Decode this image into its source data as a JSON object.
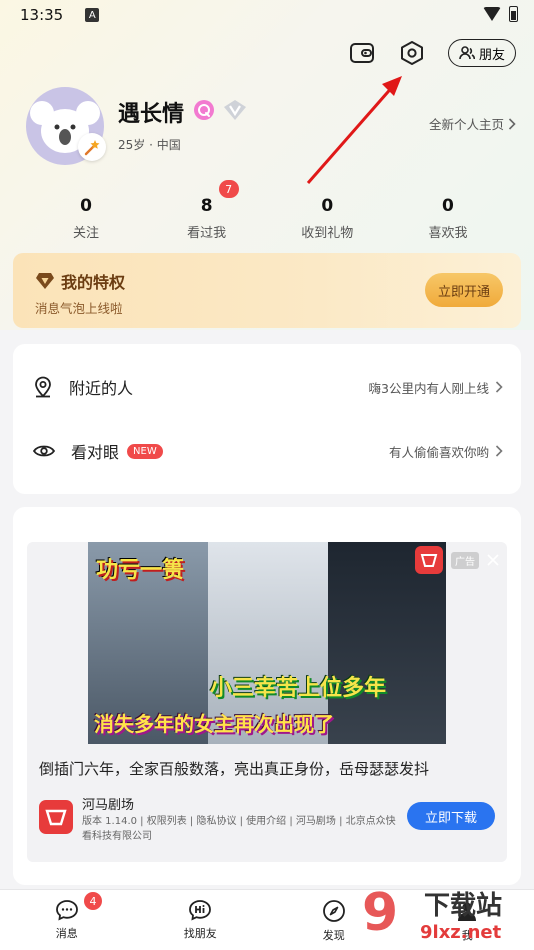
{
  "status_bar": {
    "time": "13:35",
    "indicator": "A"
  },
  "top_actions": {
    "wallet_icon": "wallet-icon",
    "settings_icon": "settings-hexagon-icon",
    "friends_label": "朋友"
  },
  "profile": {
    "username": "遇长情",
    "meta": "25岁 · 中国",
    "homepage_link": "全新个人主页",
    "badges": [
      "pink-chat-badge",
      "vip-v-badge"
    ]
  },
  "stats": [
    {
      "value": "0",
      "label": "关注"
    },
    {
      "value": "8",
      "label": "看过我",
      "badge": "7"
    },
    {
      "value": "0",
      "label": "收到礼物"
    },
    {
      "value": "0",
      "label": "喜欢我"
    }
  ],
  "privilege": {
    "title": "我的特权",
    "subtitle": "消息气泡上线啦",
    "button": "立即开通"
  },
  "menu": [
    {
      "label": "附近的人",
      "hint": "嗨3公里内有人刚上线",
      "icon": "location-pin-icon"
    },
    {
      "label": "看对眼",
      "tag": "NEW",
      "hint": "有人偷偷喜欢你哟",
      "icon": "eye-icon"
    }
  ],
  "ad": {
    "caption_top": "功亏一篑",
    "caption_mid": "小三幸苦上位多年",
    "caption_bottom": "消失多年的女主再次出现了",
    "tag": "广告",
    "title": "倒插门六年，全家百般数落，亮出真正身份，岳母瑟瑟发抖",
    "app_name": "河马剧场",
    "app_info": "版本 1.14.0 | 权限列表 | 隐私协议 | 使用介绍 | 河马剧场 | 北京点众快看科技有限公司",
    "download": "立即下载"
  },
  "tabbar": [
    {
      "label": "消息",
      "badge": "4",
      "icon": "chat-bubble-icon"
    },
    {
      "label": "找朋友",
      "icon": "hi-bubble-icon"
    },
    {
      "label": "发现",
      "icon": "compass-icon"
    },
    {
      "label": "我",
      "icon": "profile-icon"
    }
  ],
  "watermark": {
    "text": "下载站",
    "domain": "9lxz.net"
  },
  "colors": {
    "accent_red": "#f04a4a",
    "privilege_gold": "#f0aa3a",
    "download_blue": "#2a74f0"
  }
}
